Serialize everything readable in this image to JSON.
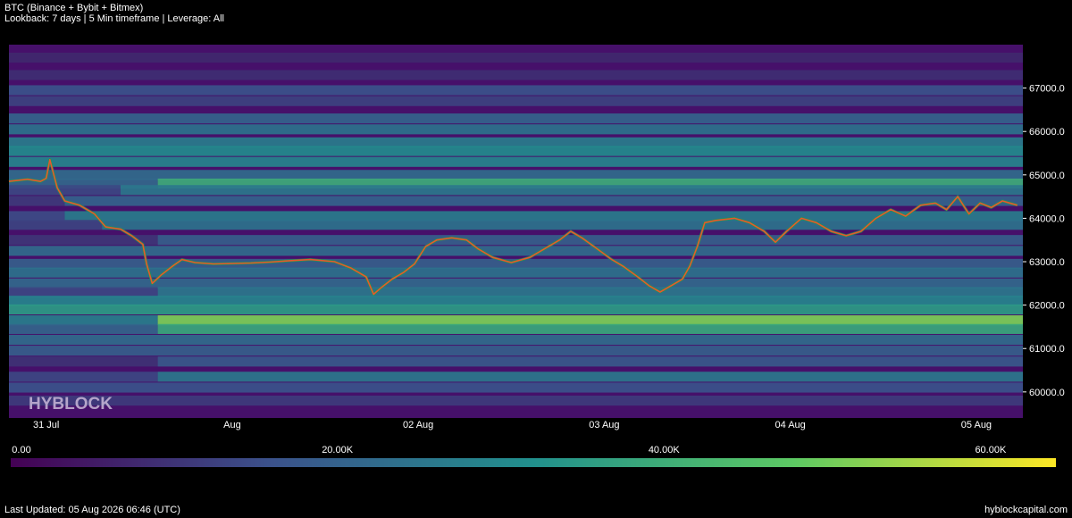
{
  "header": {
    "title": "BTC (Binance + Bybit + Bitmex)",
    "subtitle": "Lookback: 7 days | 5 Min timeframe | Leverage: All"
  },
  "watermark": "HYBLOCK",
  "footer": {
    "last_updated": "Last Updated: 05 Aug 2026 06:46 (UTC)",
    "site": "hyblockcapital.com"
  },
  "colorbar": {
    "ticks": [
      "0.00",
      "20.00K",
      "40.00K",
      "60.00K"
    ],
    "values": [
      0,
      20000,
      40000,
      60000
    ],
    "max": 64000,
    "colors": [
      "#440154",
      "#3b528b",
      "#21908d",
      "#5dc963",
      "#fde725"
    ]
  },
  "chart_data": {
    "type": "heatmap",
    "title": "BTC (Binance + Bybit + Bitmex)",
    "xlabel": "",
    "ylabel": "",
    "ylim": [
      59400,
      68000
    ],
    "y_ticks": [
      60000,
      61000,
      62000,
      63000,
      64000,
      65000,
      66000,
      67000
    ],
    "y_tick_labels": [
      "60000.0",
      "61000.0",
      "62000.0",
      "63000.0",
      "64000.0",
      "65000.0",
      "66000.0",
      "67000.0"
    ],
    "x_ticks": [
      {
        "day": 0.2,
        "label": "31 Jul"
      },
      {
        "day": 1.2,
        "label": "Aug"
      },
      {
        "day": 2.2,
        "label": "02 Aug"
      },
      {
        "day": 3.2,
        "label": "03 Aug"
      },
      {
        "day": 4.2,
        "label": "04 Aug"
      },
      {
        "day": 5.2,
        "label": "05 Aug"
      }
    ],
    "xlim_days": [
      0,
      5.45
    ],
    "price_series": {
      "type": "candlestick-line",
      "points": [
        [
          0.0,
          64850
        ],
        [
          0.1,
          64900
        ],
        [
          0.17,
          64850
        ],
        [
          0.2,
          64920
        ],
        [
          0.22,
          65350
        ],
        [
          0.26,
          64700
        ],
        [
          0.3,
          64400
        ],
        [
          0.38,
          64300
        ],
        [
          0.46,
          64100
        ],
        [
          0.52,
          63800
        ],
        [
          0.6,
          63750
        ],
        [
          0.66,
          63600
        ],
        [
          0.72,
          63400
        ],
        [
          0.74,
          62950
        ],
        [
          0.77,
          62500
        ],
        [
          0.82,
          62700
        ],
        [
          0.88,
          62900
        ],
        [
          0.93,
          63050
        ],
        [
          1.0,
          62980
        ],
        [
          1.1,
          62950
        ],
        [
          1.2,
          62960
        ],
        [
          1.3,
          62970
        ],
        [
          1.4,
          62990
        ],
        [
          1.5,
          63020
        ],
        [
          1.62,
          63050
        ],
        [
          1.75,
          63000
        ],
        [
          1.84,
          62850
        ],
        [
          1.92,
          62650
        ],
        [
          1.96,
          62250
        ],
        [
          2.0,
          62400
        ],
        [
          2.06,
          62600
        ],
        [
          2.12,
          62750
        ],
        [
          2.18,
          62950
        ],
        [
          2.24,
          63350
        ],
        [
          2.3,
          63500
        ],
        [
          2.38,
          63550
        ],
        [
          2.46,
          63500
        ],
        [
          2.52,
          63300
        ],
        [
          2.6,
          63100
        ],
        [
          2.7,
          62980
        ],
        [
          2.8,
          63100
        ],
        [
          2.88,
          63300
        ],
        [
          2.96,
          63500
        ],
        [
          3.02,
          63700
        ],
        [
          3.08,
          63550
        ],
        [
          3.16,
          63300
        ],
        [
          3.24,
          63050
        ],
        [
          3.3,
          62900
        ],
        [
          3.38,
          62650
        ],
        [
          3.44,
          62450
        ],
        [
          3.5,
          62300
        ],
        [
          3.56,
          62450
        ],
        [
          3.62,
          62600
        ],
        [
          3.66,
          62900
        ],
        [
          3.7,
          63350
        ],
        [
          3.74,
          63900
        ],
        [
          3.8,
          63950
        ],
        [
          3.9,
          64000
        ],
        [
          3.98,
          63900
        ],
        [
          4.06,
          63700
        ],
        [
          4.12,
          63450
        ],
        [
          4.18,
          63700
        ],
        [
          4.26,
          64000
        ],
        [
          4.34,
          63900
        ],
        [
          4.42,
          63700
        ],
        [
          4.5,
          63600
        ],
        [
          4.58,
          63700
        ],
        [
          4.66,
          64000
        ],
        [
          4.74,
          64200
        ],
        [
          4.82,
          64050
        ],
        [
          4.9,
          64300
        ],
        [
          4.98,
          64350
        ],
        [
          5.04,
          64200
        ],
        [
          5.1,
          64500
        ],
        [
          5.16,
          64100
        ],
        [
          5.22,
          64350
        ],
        [
          5.28,
          64250
        ],
        [
          5.34,
          64400
        ],
        [
          5.42,
          64300
        ]
      ]
    },
    "liquidation_bands": [
      {
        "price": 67700,
        "start": 0.0,
        "intensity": 0.12
      },
      {
        "price": 67300,
        "start": 0.0,
        "intensity": 0.14
      },
      {
        "price": 66950,
        "start": 0.0,
        "intensity": 0.25
      },
      {
        "price": 66700,
        "start": 0.0,
        "intensity": 0.2
      },
      {
        "price": 66300,
        "start": 0.0,
        "intensity": 0.32
      },
      {
        "price": 66050,
        "start": 0.0,
        "intensity": 0.38
      },
      {
        "price": 65750,
        "start": 0.0,
        "intensity": 0.42
      },
      {
        "price": 65550,
        "start": 0.0,
        "intensity": 0.48
      },
      {
        "price": 65300,
        "start": 0.0,
        "intensity": 0.45
      },
      {
        "price": 65000,
        "start": 0.0,
        "intensity": 0.35
      },
      {
        "price": 64800,
        "start": 0.8,
        "intensity": 0.62
      },
      {
        "price": 64650,
        "start": 0.6,
        "intensity": 0.4
      },
      {
        "price": 64400,
        "start": 0.3,
        "intensity": 0.32
      },
      {
        "price": 64050,
        "start": 0.3,
        "intensity": 0.42
      },
      {
        "price": 63850,
        "start": 0.5,
        "intensity": 0.38
      },
      {
        "price": 63500,
        "start": 0.8,
        "intensity": 0.3
      },
      {
        "price": 63250,
        "start": 0.0,
        "intensity": 0.35
      },
      {
        "price": 62950,
        "start": 0.0,
        "intensity": 0.3
      },
      {
        "price": 62750,
        "start": 0.0,
        "intensity": 0.38
      },
      {
        "price": 62500,
        "start": 0.0,
        "intensity": 0.34
      },
      {
        "price": 62300,
        "start": 0.8,
        "intensity": 0.4
      },
      {
        "price": 62100,
        "start": 0.0,
        "intensity": 0.45
      },
      {
        "price": 61900,
        "start": 0.0,
        "intensity": 0.55
      },
      {
        "price": 61650,
        "start": 0.8,
        "intensity": 0.8
      },
      {
        "price": 61450,
        "start": 0.8,
        "intensity": 0.6
      },
      {
        "price": 61200,
        "start": 0.0,
        "intensity": 0.35
      },
      {
        "price": 60950,
        "start": 0.0,
        "intensity": 0.3
      },
      {
        "price": 60700,
        "start": 0.8,
        "intensity": 0.28
      },
      {
        "price": 60350,
        "start": 0.8,
        "intensity": 0.4
      },
      {
        "price": 60100,
        "start": 0.0,
        "intensity": 0.25
      },
      {
        "price": 59800,
        "start": 0.0,
        "intensity": 0.18
      }
    ]
  }
}
